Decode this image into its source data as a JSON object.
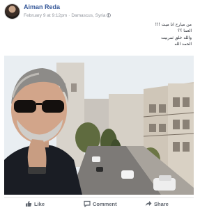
{
  "post": {
    "author": "Aiman Reda",
    "date": "February 9 at 9:12pm",
    "separator": "·",
    "location": "Damascus, Syria",
    "audience_icon": "globe-icon",
    "text_lines": [
      "من مبارح انا ميت !!!",
      "العما ؟؟",
      "والله خلق ثمرنيت",
      "الحمد الله"
    ]
  },
  "actions": {
    "like_label": "Like",
    "comment_label": "Comment",
    "share_label": "Share"
  },
  "colors": {
    "name_link": "#365899",
    "meta_text": "#90949c",
    "action_text": "#616770"
  }
}
